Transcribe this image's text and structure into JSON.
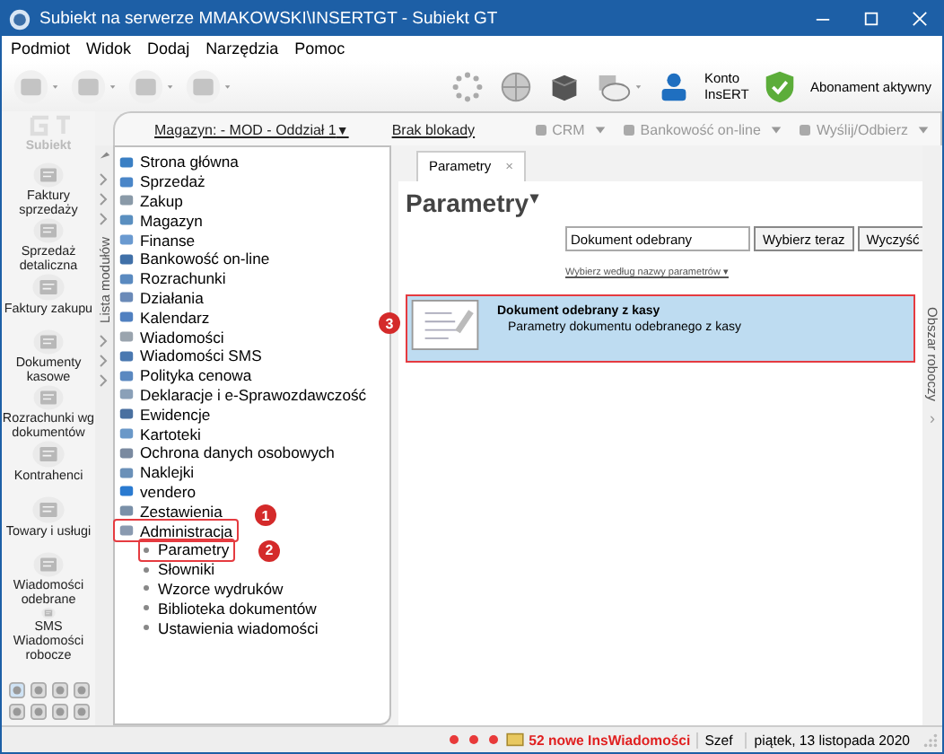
{
  "window": {
    "title": "Subiekt na serwerze MMAKOWSKI\\INSERTGT - Subiekt GT"
  },
  "menu": [
    "Podmiot",
    "Widok",
    "Dodaj",
    "Narzędzia",
    "Pomoc"
  ],
  "toolbar": {
    "account": "Konto InsERT",
    "subscription": "Abonament aktywny"
  },
  "top_strip": {
    "warehouse": "Magazyn: - MOD - Oddział 1",
    "warehouse_caret": "▼",
    "lock": "Brak blokady",
    "actions": [
      {
        "label": "CRM",
        "disabled": true
      },
      {
        "label": "Bankowość on-line",
        "disabled": true
      },
      {
        "label": "Wyślij/Odbierz",
        "disabled": true
      }
    ]
  },
  "sidebar": {
    "logo": "Subiekt",
    "items": [
      {
        "label": "Faktury sprzedaży"
      },
      {
        "label": "Sprzedaż detaliczna"
      },
      {
        "label": "Faktury zakupu"
      },
      {
        "label": "Dokumenty kasowe"
      },
      {
        "label": "Rozrachunki wg dokumentów"
      },
      {
        "label": "Kontrahenci"
      },
      {
        "label": "Towary i usługi"
      },
      {
        "label": "Wiadomości odebrane"
      },
      {
        "label": "SMS Wiadomości robocze"
      }
    ]
  },
  "modules": {
    "strip_label": "Lista modułów",
    "items": [
      {
        "label": "Strona główna",
        "color": "#3a7fc4"
      },
      {
        "label": "Sprzedaż",
        "color": "#4a86c8"
      },
      {
        "label": "Zakup",
        "color": "#8a9aa8"
      },
      {
        "label": "Magazyn",
        "color": "#5a8fc0"
      },
      {
        "label": "Finanse",
        "color": "#6a9ad0"
      },
      {
        "label": "Bankowość on-line",
        "color": "#4070a8"
      },
      {
        "label": "Rozrachunki",
        "color": "#5a8ac0"
      },
      {
        "label": "Działania",
        "color": "#6a8ab8"
      },
      {
        "label": "Kalendarz",
        "color": "#5080c0"
      },
      {
        "label": "Wiadomości",
        "color": "#9aa4ae"
      },
      {
        "label": "Wiadomości SMS",
        "color": "#4a78b0"
      },
      {
        "label": "Polityka cenowa",
        "color": "#5a88c0"
      },
      {
        "label": "Deklaracje i e-Sprawozdawczość",
        "color": "#8aa0b8"
      },
      {
        "label": "Ewidencje",
        "color": "#4a70a0"
      },
      {
        "label": "Kartoteki",
        "color": "#6a98c8"
      },
      {
        "label": "Ochrona danych osobowych",
        "color": "#7a8aa0"
      },
      {
        "label": "Naklejki",
        "color": "#6a90b8"
      },
      {
        "label": "vendero",
        "color": "#2a7ad0"
      },
      {
        "label": "Zestawienia",
        "color": "#7a90a8"
      },
      {
        "label": "Administracja",
        "color": "#8a9ab0",
        "callout": "1",
        "expanded": true,
        "children": [
          {
            "label": "Parametry",
            "selected": true,
            "callout": "2"
          },
          {
            "label": "Słowniki",
            "selected": false
          },
          {
            "label": "Wzorce wydruków",
            "selected": false
          },
          {
            "label": "Biblioteka dokumentów",
            "selected": false
          },
          {
            "label": "Ustawienia wiadomości",
            "selected": false
          }
        ]
      }
    ]
  },
  "content": {
    "tab": {
      "label": "Parametry",
      "close": "×"
    },
    "heading": "Parametry",
    "heading_caret": "▾",
    "search": {
      "value": "Dokument odebrany"
    },
    "buttons": [
      "Wybierz teraz",
      "Wyczyść"
    ],
    "filter_link": "Wybierz według nazwy parametrów ▾",
    "results": [
      {
        "title": "Dokument odebrany z kasy",
        "description": "Parametry dokumentu odebranego z kasy",
        "selected": true,
        "callout": "3"
      }
    ],
    "side_strip": "Obszar roboczy",
    "side_arrow": "›"
  },
  "status_bar": {
    "messages": "52 nowe InsWiadomości",
    "user": "Szef",
    "date": "piątek, 13 listopada 2020"
  }
}
